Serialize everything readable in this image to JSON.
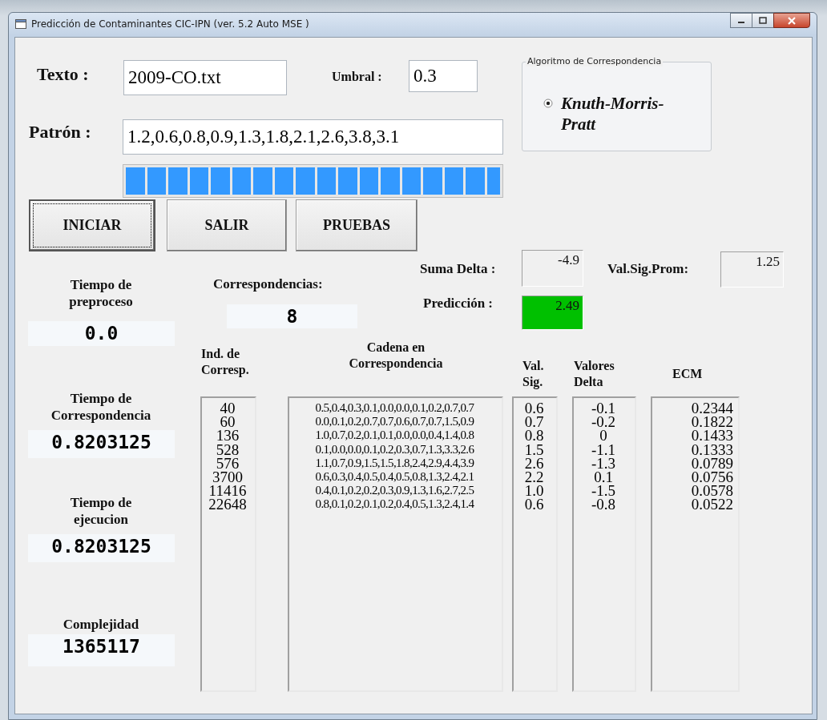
{
  "window": {
    "title": "Predicción de Contaminantes CIC-IPN (ver. 5.2 Auto MSE )"
  },
  "texto": {
    "label": "Texto :",
    "value": "2009-CO.txt"
  },
  "umbral": {
    "label": "Umbral :",
    "value": "0.3"
  },
  "algorithm_group": {
    "legend": "Algoritmo de Correspondencia",
    "options": [
      {
        "label": "Knuth-Morris-Pratt",
        "selected": true
      }
    ]
  },
  "patron": {
    "label": "Patrón :",
    "value": "1.2,0.6,0.8,0.9,1.3,1.8,2.1,2.6,3.8,3.1"
  },
  "progress": {
    "level": 1
  },
  "buttons": [
    {
      "label": "INICIAR",
      "focused": true
    },
    {
      "label": "SALIR",
      "focused": false
    },
    {
      "label": "PRUEBAS",
      "focused": false
    }
  ],
  "suma_delta": {
    "label": "Suma Delta :",
    "value": "-4.9"
  },
  "val_sig_prom": {
    "label": "Val.Sig.Prom:",
    "value": "1.25"
  },
  "prediccion": {
    "label": "Predicción :",
    "value": "2.49",
    "highlighted": true
  },
  "correspondencias": {
    "label": "Correspondencias:",
    "value": "8"
  },
  "timings": [
    {
      "label": "Tiempo de preproceso",
      "value": "0.0"
    },
    {
      "label": "Tiempo de Correspondencia",
      "value": "0.8203125"
    },
    {
      "label": "Tiempo de ejecucion",
      "value": "0.8203125"
    },
    {
      "label": "Complejidad",
      "value": "1365117"
    }
  ],
  "list_columns": [
    {
      "header": "Ind. de Corresp.",
      "values": [
        "40",
        "60",
        "136",
        "528",
        "576",
        "3700",
        "11416",
        "22648"
      ]
    },
    {
      "header": "Cadena en Correspondencia",
      "values": [
        "0.5,0.4,0.3,0.1,0.0,0.0,0.1,0.2,0.7,0.7",
        "0.0,0.1,0.2,0.7,0.7,0.6,0.7,0.7,1.5,0.9",
        "1.0,0.7,0.2,0.1,0.1,0.0,0.0,0.4,1.4,0.8",
        "0.1,0.0,0.0,0.1,0.2,0.3,0.7,1.3,3.3,2.6",
        "1.1,0.7,0.9,1.5,1.5,1.8,2.4,2.9,4.4,3.9",
        "0.6,0.3,0.4,0.5,0.4,0.5,0.8,1.3,2.4,2.1",
        "0.4,0.1,0.2,0.2,0.3,0.9,1.3,1.6,2.7,2.5",
        "0.8,0.1,0.2,0.1,0.2,0.4,0.5,1.3,2.4,1.4"
      ]
    },
    {
      "header": "Val. Sig.",
      "values": [
        "0.6",
        "0.7",
        "0.8",
        "1.5",
        "2.6",
        "2.2",
        "1.0",
        "0.6"
      ]
    },
    {
      "header": "Valores Delta",
      "values": [
        "-0.1",
        "-0.2",
        "0",
        "-1.1",
        "-1.3",
        "0.1",
        "-1.5",
        "-0.8"
      ]
    },
    {
      "header": "ECM",
      "values": [
        "0.2344",
        "0.1822",
        "0.1433",
        "0.1333",
        "0.0789",
        "0.0756",
        "0.0578",
        "0.0522"
      ]
    }
  ]
}
